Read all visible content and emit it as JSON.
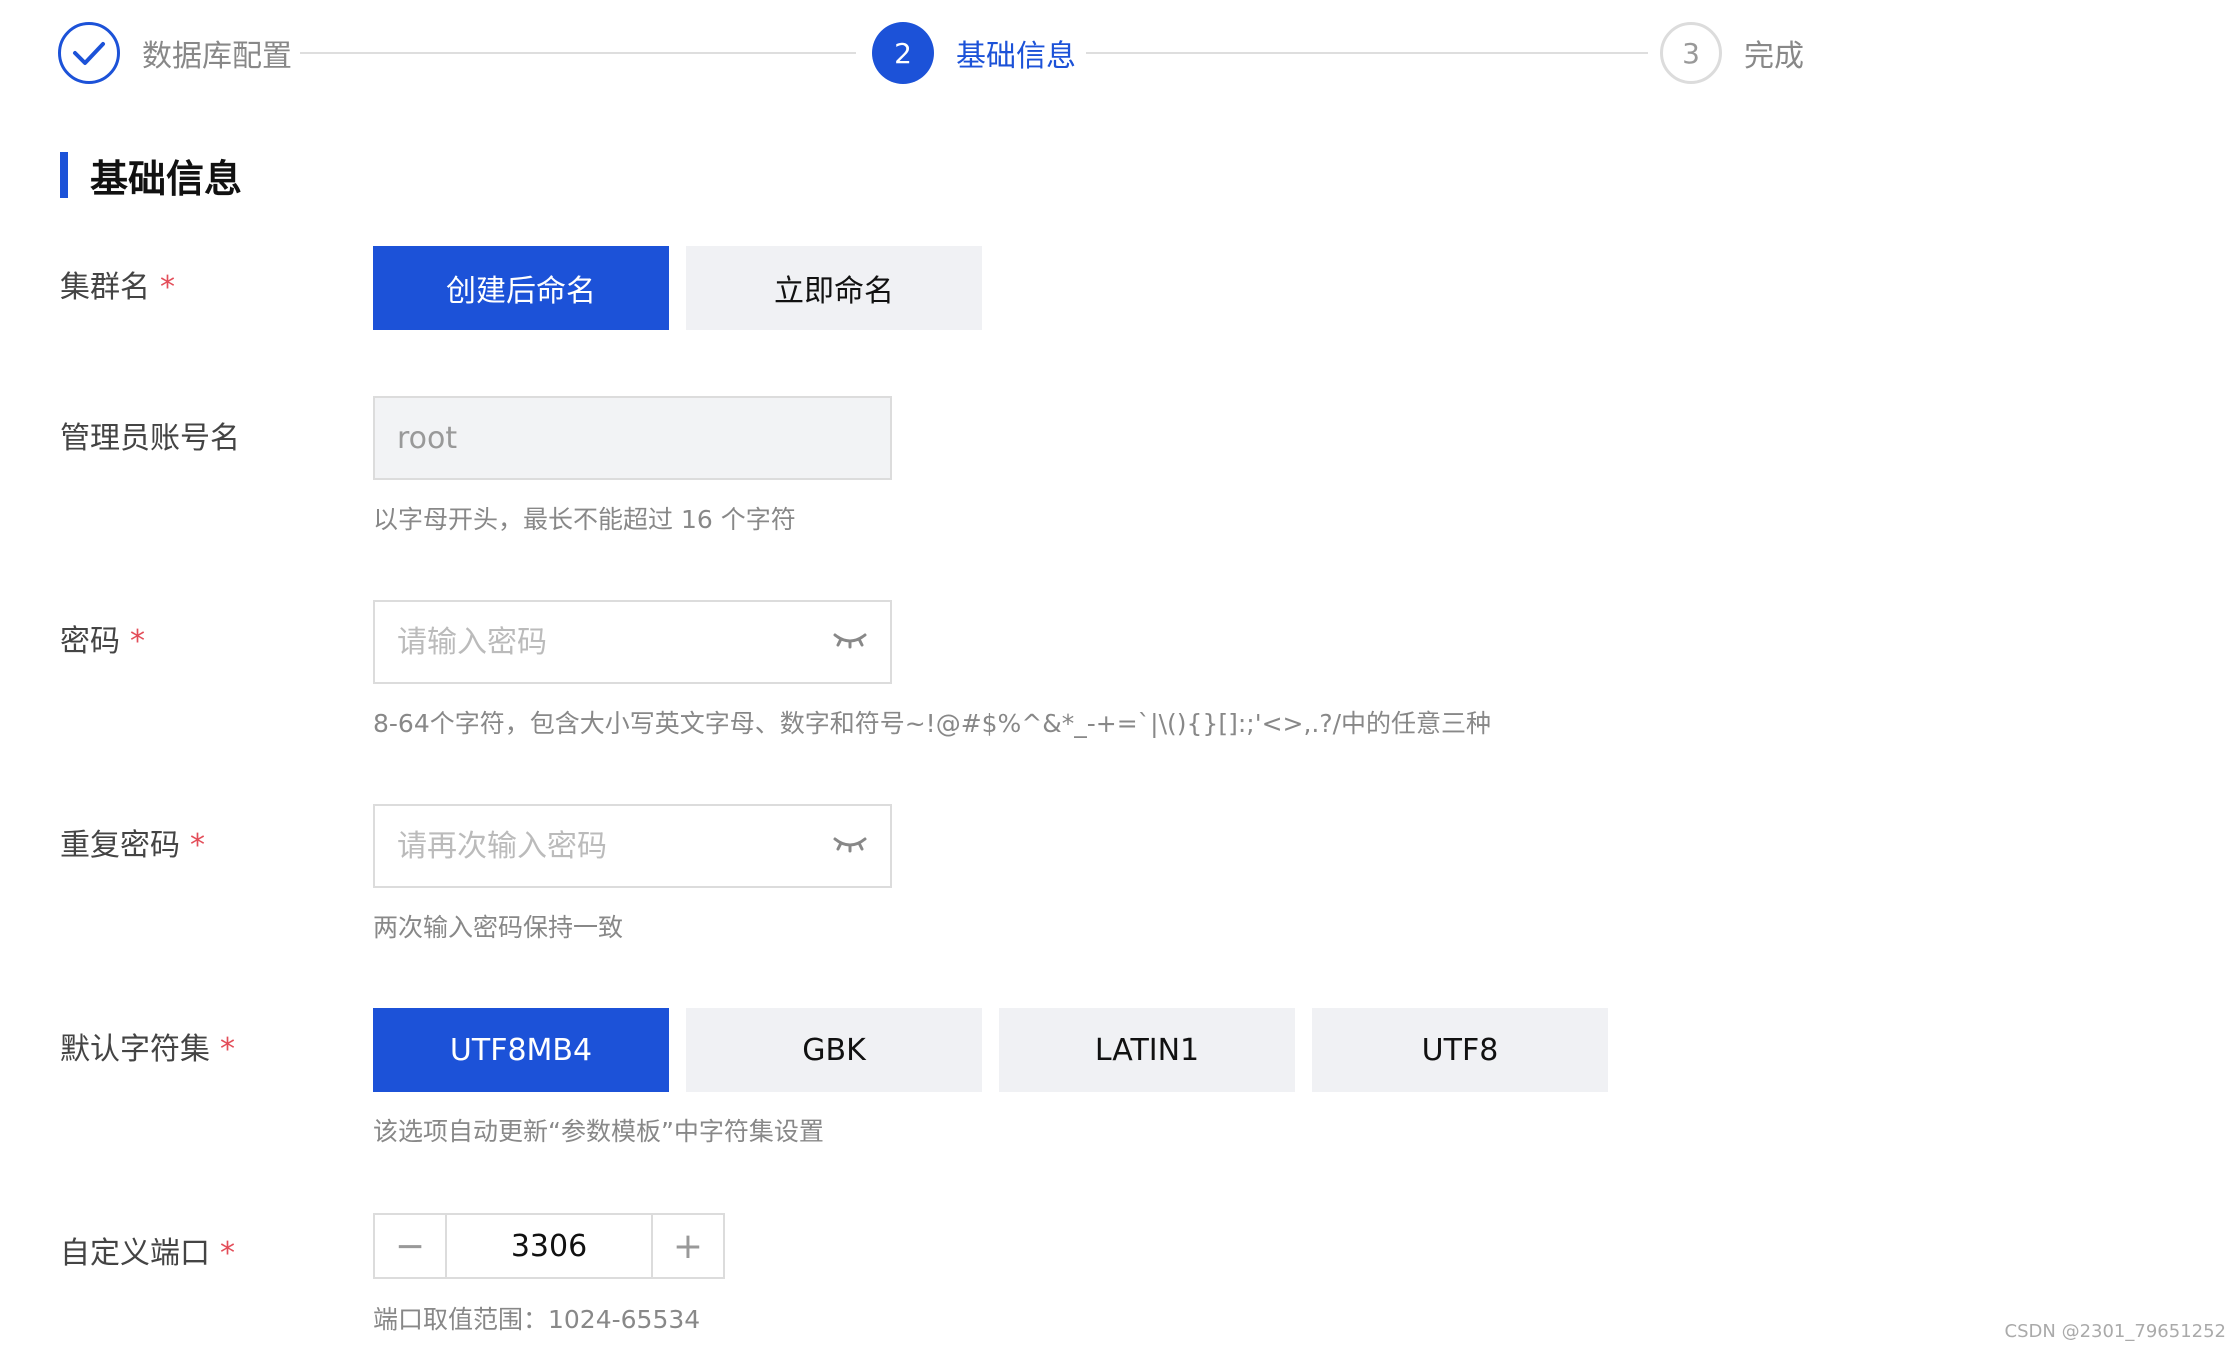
{
  "steps": [
    {
      "number": "",
      "label": "数据库配置",
      "state": "done"
    },
    {
      "number": "2",
      "label": "基础信息",
      "state": "active"
    },
    {
      "number": "3",
      "label": "完成",
      "state": "todo"
    }
  ],
  "section_title": "基础信息",
  "cluster_name": {
    "label": "集群名",
    "required_mark": "*",
    "options": [
      "创建后命名",
      "立即命名"
    ],
    "selected": "创建后命名"
  },
  "admin_account": {
    "label": "管理员账号名",
    "value": "root",
    "hint": "以字母开头，最长不能超过 16 个字符"
  },
  "password": {
    "label": "密码",
    "required_mark": "*",
    "placeholder": "请输入密码",
    "hint": "8-64个字符，包含大小写英文字母、数字和符号~!@#$%^&*_-+=`|\\(){}[]:;'<>,.?/中的任意三种"
  },
  "repeat_password": {
    "label": "重复密码",
    "required_mark": "*",
    "placeholder": "请再次输入密码",
    "hint": "两次输入密码保持一致"
  },
  "charset": {
    "label": "默认字符集",
    "required_mark": "*",
    "options": [
      "UTF8MB4",
      "GBK",
      "LATIN1",
      "UTF8"
    ],
    "selected": "UTF8MB4",
    "hint": "该选项自动更新“参数模板”中字符集设置"
  },
  "port": {
    "label": "自定义端口",
    "required_mark": "*",
    "value": "3306",
    "minus": "−",
    "plus": "+",
    "hint": "端口取值范围：1024-65534"
  },
  "watermark": "CSDN @2301_79651252",
  "colors": {
    "primary": "#1c52d8",
    "required": "#e34d59"
  },
  "icons": {
    "done_step": "check-icon",
    "password_toggle": "eye-closed-icon"
  }
}
